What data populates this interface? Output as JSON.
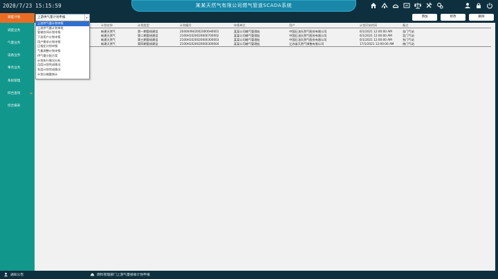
{
  "header": {
    "datetime": "2020/7/23 15:15:59",
    "title": "某某天然气有限公司燃气管道SCADA系统"
  },
  "header_icons": [
    "home-icon",
    "pipeline-icon",
    "bridge-icon",
    "flow-icon",
    "scale-icon",
    "tools-icon",
    "settings-icon",
    "user-icon",
    "lock-icon",
    "power-icon"
  ],
  "sidebar": {
    "items": [
      {
        "label": "调度计划",
        "active": true
      },
      {
        "label": "调度业务",
        "active": false
      },
      {
        "label": "气量业务",
        "active": false
      },
      {
        "label": "设备业务",
        "active": false
      },
      {
        "label": "事务业务",
        "active": false
      },
      {
        "label": "系统管理",
        "active": false
      },
      {
        "label": "综合查询",
        "active": false,
        "arrow": "»"
      },
      {
        "label": "综合报表",
        "active": false
      }
    ]
  },
  "filter": {
    "selected": "上游供气量计划申报",
    "caret": "▾"
  },
  "toolbar": {
    "add_label": "添加",
    "edit_label": "修改",
    "delete_label": "删除"
  },
  "dropdown": {
    "items": [
      {
        "label": "上游供气量计划申报",
        "selected": true
      },
      {
        "label": "上游供气量计划审批",
        "selected": false
      },
      {
        "label": "管输合同计划申报",
        "selected": false
      },
      {
        "label": "下游用户计划申报",
        "selected": false
      },
      {
        "label": "用户需求计划申报",
        "selected": false
      },
      {
        "label": "日指定计划申报",
        "selected": false
      },
      {
        "label": "气量调整计划申报",
        "selected": false
      },
      {
        "label": "供气量分配方案",
        "selected": false
      },
      {
        "label": "计划执行情况分析",
        "selected": false
      },
      {
        "label": "月度计划完成情况",
        "selected": false
      },
      {
        "label": "年度计划完成情况",
        "selected": false
      },
      {
        "label": "计划分输量统计",
        "selected": false
      }
    ]
  },
  "table": {
    "columns": [
      "计划名称",
      "计划类型",
      "计划编号",
      "申报单位",
      "用户",
      "计划开始时间",
      "备注"
    ],
    "rows": [
      [
        "新建天然气",
        "第一期管线建设",
        "2040049420020000H0001",
        "某某公司输气管理处",
        "中国石油天然气股份有限公司",
        "6/1/2021 12:00:00 AM",
        "金门气站"
      ],
      [
        "新建天然气",
        "第二期管线建设",
        "2100H1020020000700002",
        "某某公司输气管理处",
        "中国石油天然气股份有限公司",
        "6/1/2021 12:00:00 AM",
        "北门气站"
      ],
      [
        "新建天然气",
        "第三期管线建设",
        "2100H1020020000300003",
        "某某公司输气管理处",
        "中国石油天然气股份有限公司",
        "6/1/2021 12:00:00 AM",
        "东门气站"
      ],
      [
        "新建天然气",
        "第四期管线建设",
        "2100H1020020000300004",
        "某某公司输气管理处",
        "江苏省天然气销售有限公司",
        "17/1/2021 12:00:00 AM",
        "南门气站"
      ]
    ]
  },
  "footer": {
    "left_label": "通知公告",
    "message": "燃料管理部门上游气量接收计划申报"
  },
  "colors": {
    "header_bg": "#0e2f3e",
    "title_pill": "#1a87a8",
    "sidebar_bg": "#12978d",
    "active_item": "#e86d24",
    "content_bg": "#f1f1f1"
  }
}
